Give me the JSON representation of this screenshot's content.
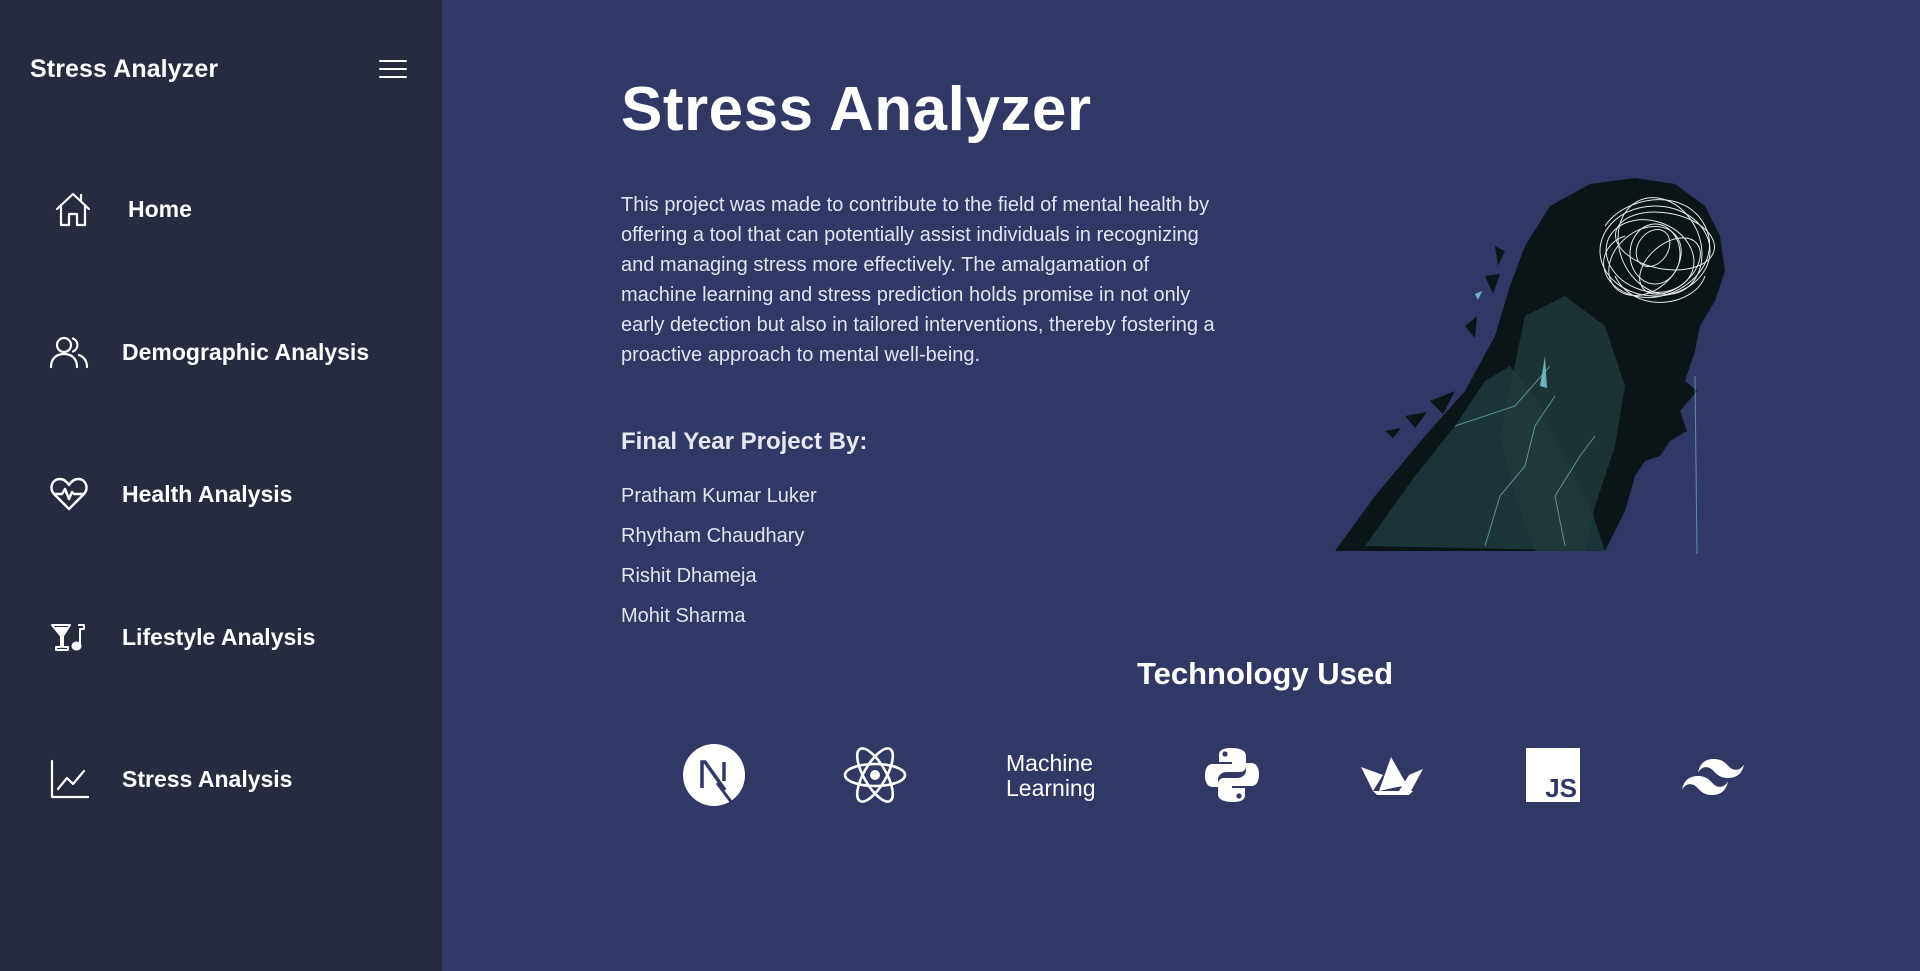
{
  "sidebar": {
    "brand": "Stress Analyzer",
    "items": [
      {
        "label": "Home",
        "icon": "home-icon"
      },
      {
        "label": "Demographic Analysis",
        "icon": "users-icon"
      },
      {
        "label": "Health Analysis",
        "icon": "heart-pulse-icon"
      },
      {
        "label": "Lifestyle Analysis",
        "icon": "cocktail-music-icon"
      },
      {
        "label": "Stress Analysis",
        "icon": "line-chart-icon"
      }
    ]
  },
  "main": {
    "title": "Stress Analyzer",
    "description": "This project was made to contribute to the field of mental health by offering a tool that can potentially assist individuals in recognizing and managing stress more effectively. The amalgamation of machine learning and stress prediction holds promise in not only early detection but also in tailored interventions, thereby fostering a proactive approach to mental well-being.",
    "team_heading": "Final Year Project By:",
    "team": [
      "Pratham Kumar Luker",
      "Rhytham Chaudhary",
      "Rishit Dhameja",
      "Mohit Sharma"
    ],
    "tech_heading": "Technology Used",
    "tech": [
      {
        "name": "nextjs-icon"
      },
      {
        "name": "react-icon"
      },
      {
        "label_line1": "Machine",
        "label_line2": "Learning"
      },
      {
        "name": "python-icon"
      },
      {
        "name": "streamlit-icon"
      },
      {
        "name": "javascript-icon",
        "text": "JS"
      },
      {
        "name": "tailwind-icon"
      }
    ]
  },
  "colors": {
    "sidebar_bg": "#262b3f",
    "main_bg": "#323865",
    "text": "#ffffff"
  }
}
